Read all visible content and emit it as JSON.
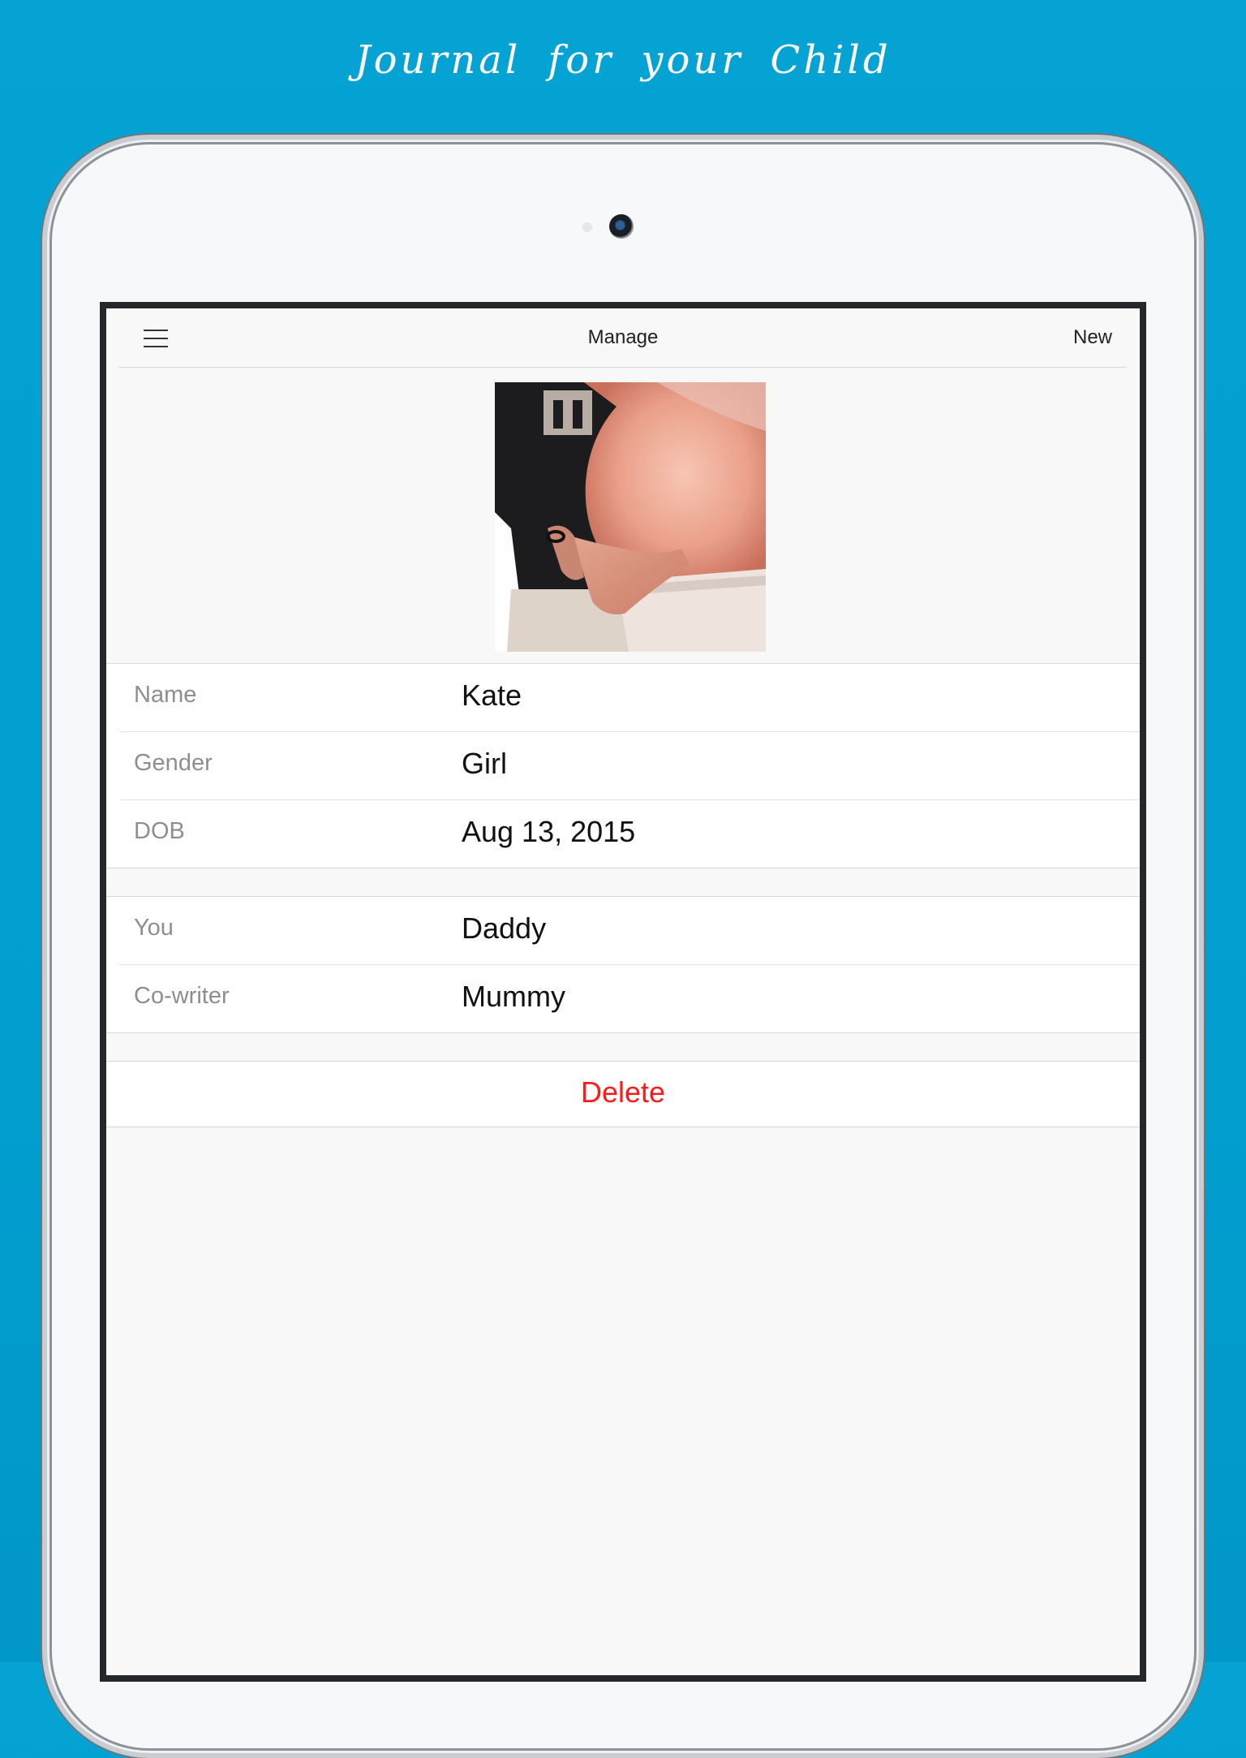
{
  "headline": "Journal for your Child",
  "navbar": {
    "menu_icon": "hamburger-menu-icon",
    "title": "Manage",
    "new_label": "New"
  },
  "photo": {
    "subject": "child-profile-photo"
  },
  "profile": {
    "rows": [
      {
        "label": "Name",
        "value": "Kate"
      },
      {
        "label": "Gender",
        "value": "Girl"
      },
      {
        "label": "DOB",
        "value": "Aug 13, 2015"
      }
    ]
  },
  "writers": {
    "rows": [
      {
        "label": "You",
        "value": "Daddy"
      },
      {
        "label": "Co-writer",
        "value": "Mummy"
      }
    ]
  },
  "actions": {
    "delete_label": "Delete"
  },
  "colors": {
    "background": "#05a3d3",
    "delete": "#ff1a1a",
    "label": "#8e8e8e"
  }
}
